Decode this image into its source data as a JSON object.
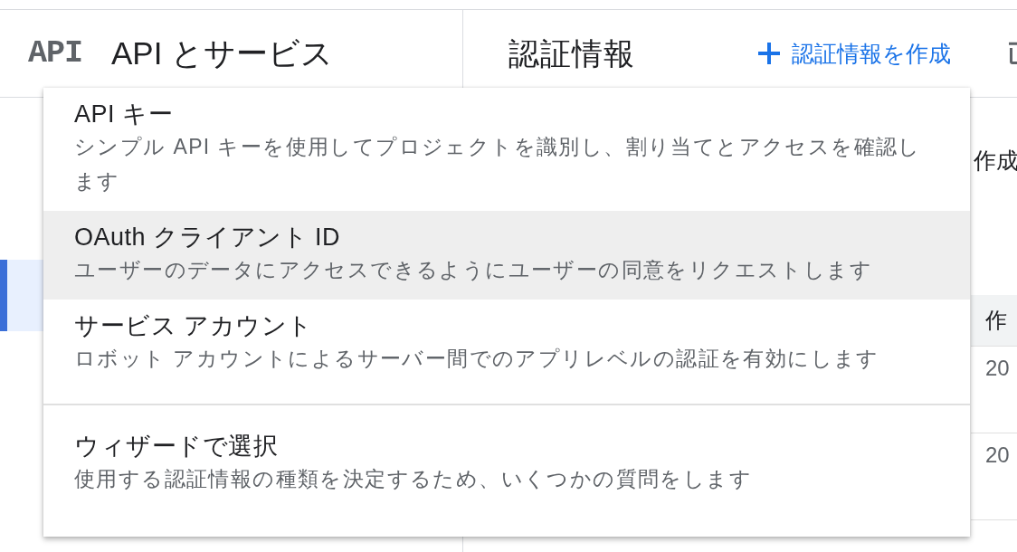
{
  "sidebar": {
    "logo": "API",
    "title": "API とサービス",
    "items": [
      {
        "selected": true
      }
    ]
  },
  "header": {
    "title": "認証情報",
    "create_button": "認証情報を作成"
  },
  "content": {
    "intro_text": "作成",
    "table": {
      "columns": [
        "作"
      ],
      "rows": [
        [
          "20"
        ],
        [
          "20"
        ]
      ]
    }
  },
  "menu": {
    "groups": [
      {
        "items": [
          {
            "title": "API キー",
            "description": "シンプル API キーを使用してプロジェクトを識別し、割り当てとアクセスを確認します",
            "highlighted": false
          },
          {
            "title": "OAuth クライアント ID",
            "description": "ユーザーのデータにアクセスできるようにユーザーの同意をリクエストします",
            "highlighted": true
          },
          {
            "title": "サービス アカウント",
            "description": "ロボット アカウントによるサーバー間でのアプリレベルの認証を有効にします",
            "highlighted": false
          }
        ]
      },
      {
        "items": [
          {
            "title": "ウィザードで選択",
            "description": "使用する認証情報の種類を決定するため、いくつかの質問をします",
            "highlighted": false
          }
        ]
      }
    ]
  }
}
